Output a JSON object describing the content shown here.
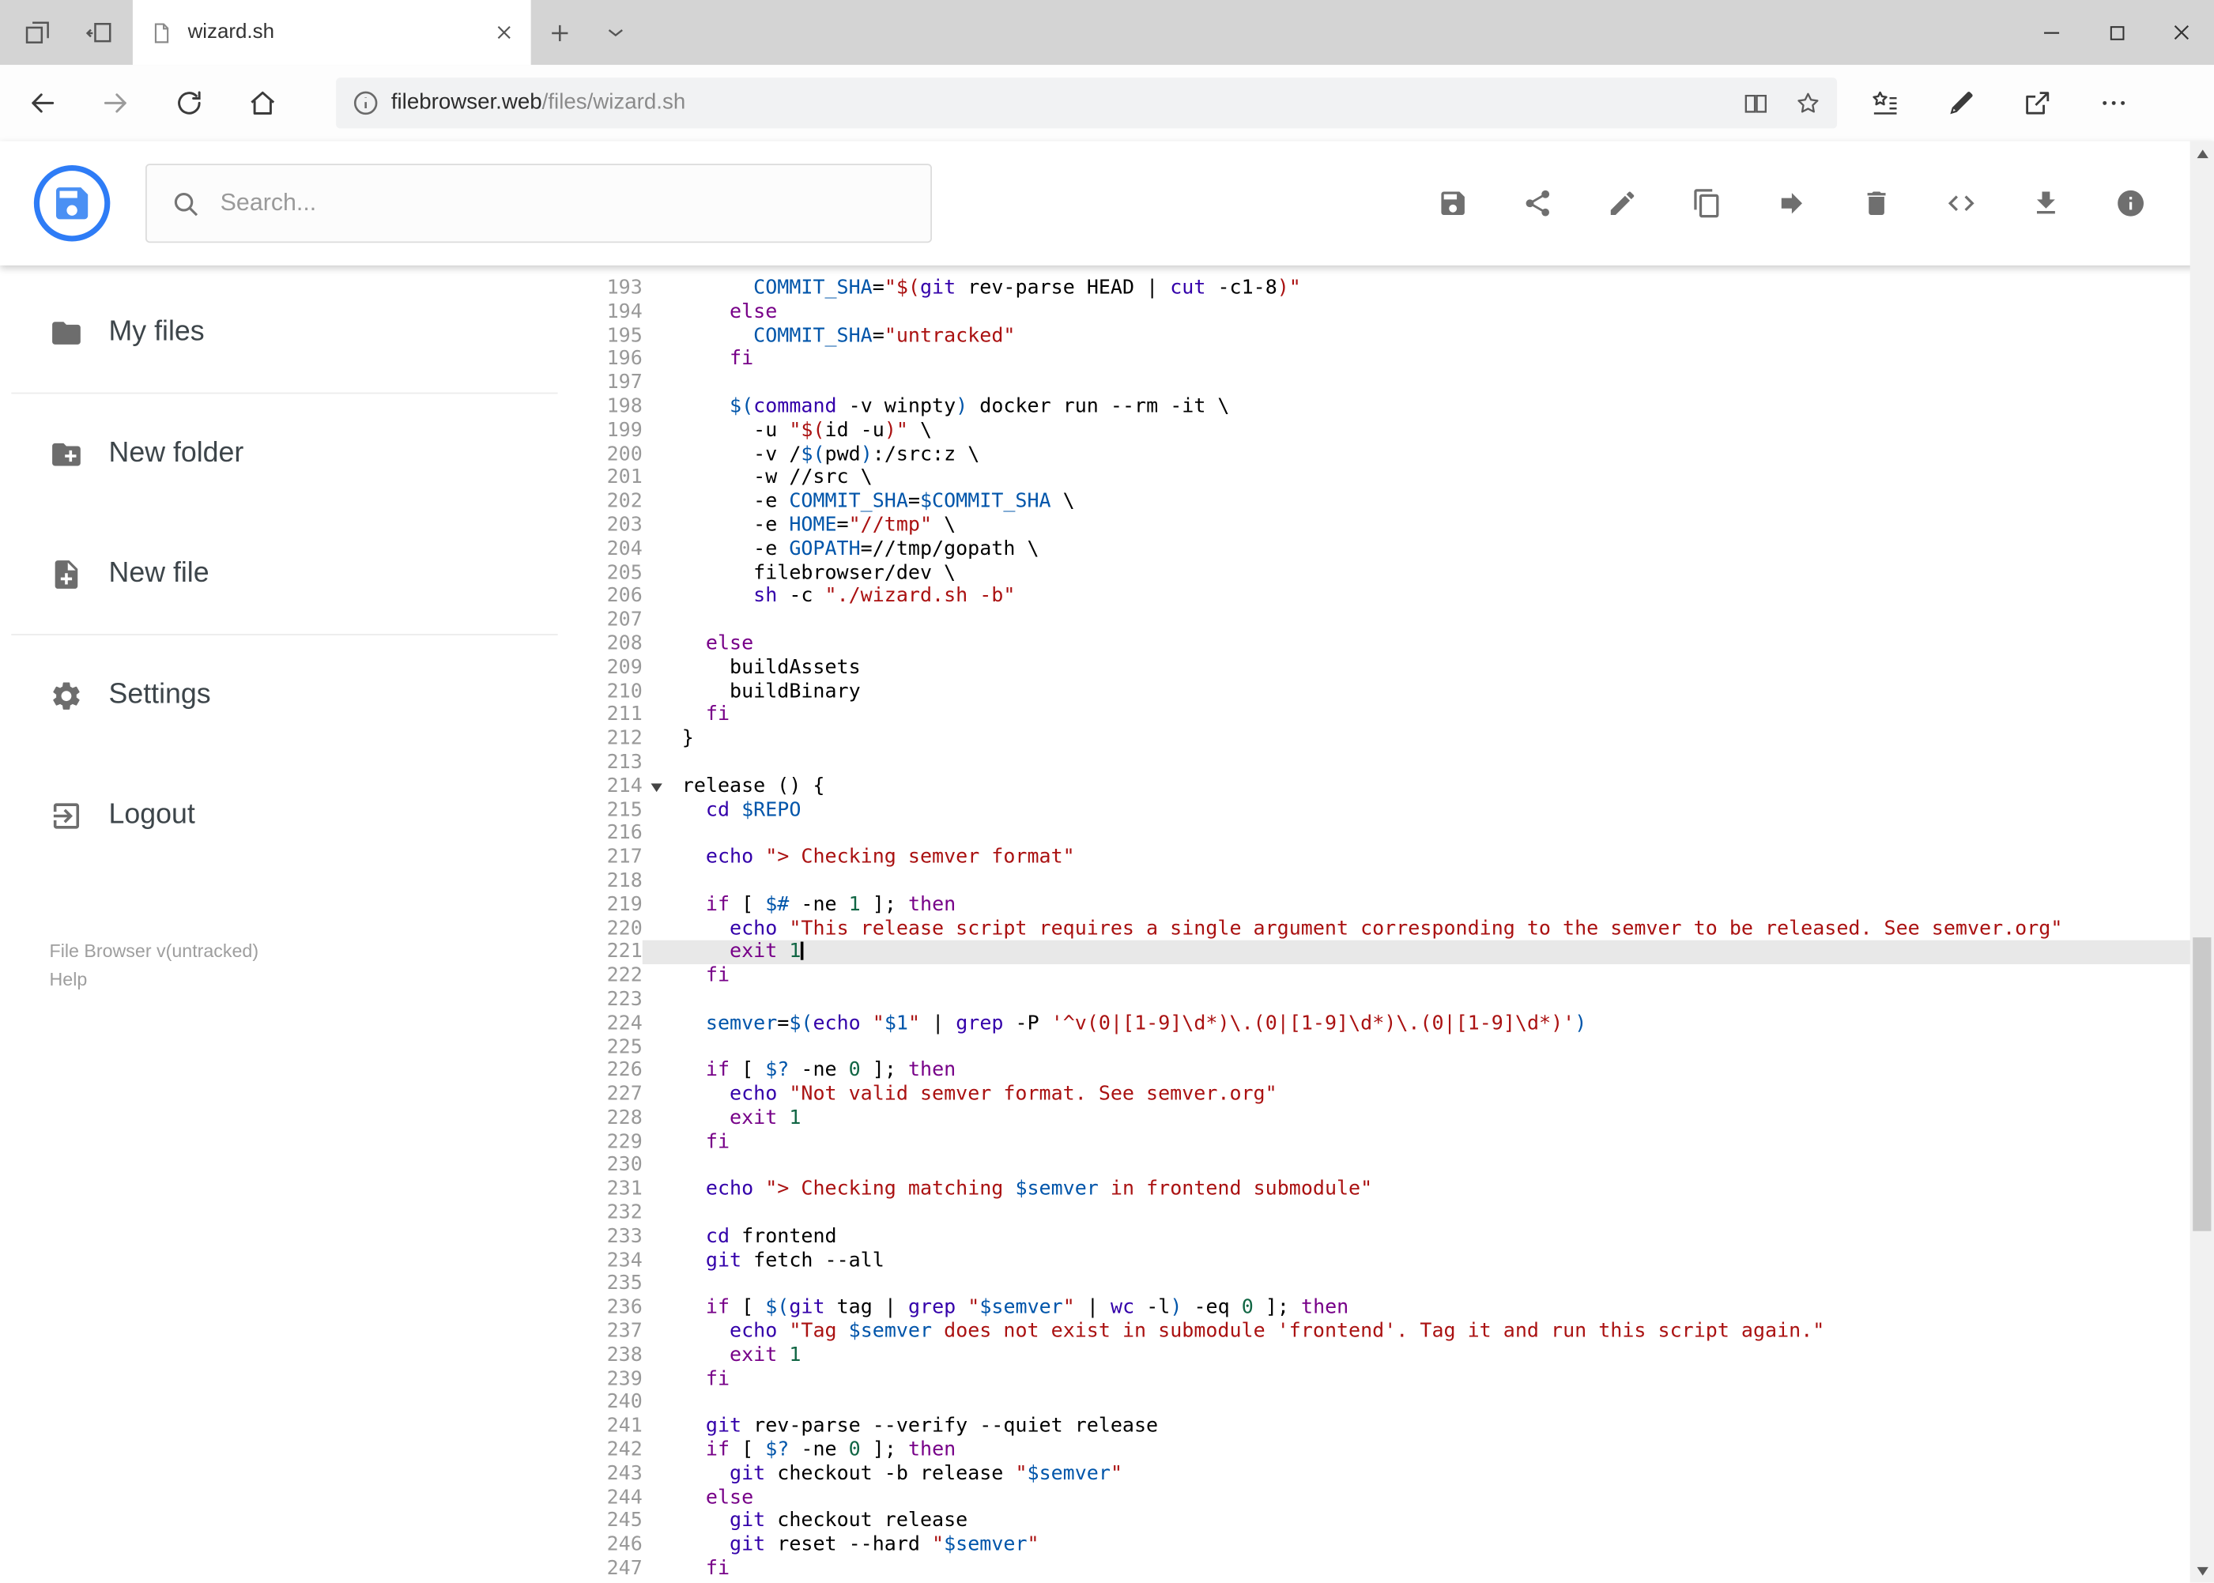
{
  "browser": {
    "tab_title": "wizard.sh",
    "url_domain": "filebrowser.web",
    "url_path": "/files/wizard.sh"
  },
  "header": {
    "search_placeholder": "Search...",
    "toolbar": [
      "save",
      "share",
      "edit",
      "copy",
      "move",
      "delete",
      "code",
      "download",
      "info"
    ]
  },
  "sidebar": {
    "items": [
      {
        "id": "my-files",
        "label": "My files",
        "icon": "folder-icon",
        "divider_after": true
      },
      {
        "id": "new-folder",
        "label": "New folder",
        "icon": "new-folder-icon",
        "divider_after": false
      },
      {
        "id": "new-file",
        "label": "New file",
        "icon": "new-file-icon",
        "divider_after": true
      },
      {
        "id": "settings",
        "label": "Settings",
        "icon": "settings-icon",
        "divider_after": false
      },
      {
        "id": "logout",
        "label": "Logout",
        "icon": "logout-icon",
        "divider_after": false
      }
    ],
    "footer": {
      "version": "File Browser v(untracked)",
      "help": "Help"
    }
  },
  "colors": {
    "accent_blue": "#2e7cf6",
    "tok_string": "#aa1111",
    "tok_keyword": "#770088",
    "tok_variable": "#0055aa",
    "tok_builtin": "#3300aa",
    "tok_number": "#116644"
  },
  "editor": {
    "active_line": 221,
    "fold_line": 214,
    "lines": [
      {
        "n": 193,
        "t": [
          [
            "      ",
            ""
          ],
          [
            "COMMIT_SHA",
            "v"
          ],
          [
            "=",
            ""
          ],
          [
            "\"$(",
            "s"
          ],
          [
            "git",
            "b"
          ],
          [
            " rev-parse HEAD | ",
            ""
          ],
          [
            "cut",
            "b"
          ],
          [
            " -c1-8",
            ""
          ],
          [
            ")\"",
            "s"
          ]
        ]
      },
      {
        "n": 194,
        "t": [
          [
            "    ",
            ""
          ],
          [
            "else",
            "k"
          ]
        ]
      },
      {
        "n": 195,
        "t": [
          [
            "      ",
            ""
          ],
          [
            "COMMIT_SHA",
            "v"
          ],
          [
            "=",
            ""
          ],
          [
            "\"untracked\"",
            "s"
          ]
        ]
      },
      {
        "n": 196,
        "t": [
          [
            "    ",
            ""
          ],
          [
            "fi",
            "k"
          ]
        ]
      },
      {
        "n": 197,
        "t": []
      },
      {
        "n": 198,
        "t": [
          [
            "    ",
            ""
          ],
          [
            "$(",
            "v"
          ],
          [
            "command",
            "b"
          ],
          [
            " -v winpty",
            ""
          ],
          [
            ")",
            "v"
          ],
          [
            " docker run --rm -it \\",
            ""
          ]
        ]
      },
      {
        "n": 199,
        "t": [
          [
            "      -u ",
            ""
          ],
          [
            "\"$(",
            "s"
          ],
          [
            "id -u",
            ""
          ],
          [
            ")\"",
            "s"
          ],
          [
            " \\",
            ""
          ]
        ]
      },
      {
        "n": 200,
        "t": [
          [
            "      -v /",
            ""
          ],
          [
            "$(",
            "v"
          ],
          [
            "pwd",
            ""
          ],
          [
            ")",
            "v"
          ],
          [
            ":/src:z \\",
            ""
          ]
        ]
      },
      {
        "n": 201,
        "t": [
          [
            "      -w //src \\",
            ""
          ]
        ]
      },
      {
        "n": 202,
        "t": [
          [
            "      -e ",
            ""
          ],
          [
            "COMMIT_SHA",
            "v"
          ],
          [
            "=",
            ""
          ],
          [
            "$COMMIT_SHA",
            "v"
          ],
          [
            " \\",
            ""
          ]
        ]
      },
      {
        "n": 203,
        "t": [
          [
            "      -e ",
            ""
          ],
          [
            "HOME",
            "v"
          ],
          [
            "=",
            ""
          ],
          [
            "\"//tmp\"",
            "s"
          ],
          [
            " \\",
            ""
          ]
        ]
      },
      {
        "n": 204,
        "t": [
          [
            "      -e ",
            ""
          ],
          [
            "GOPATH",
            "v"
          ],
          [
            "=//tmp/gopath \\",
            ""
          ]
        ]
      },
      {
        "n": 205,
        "t": [
          [
            "      filebrowser/dev \\",
            ""
          ]
        ]
      },
      {
        "n": 206,
        "t": [
          [
            "      ",
            ""
          ],
          [
            "sh",
            "b"
          ],
          [
            " -c ",
            ""
          ],
          [
            "\"./wizard.sh -b\"",
            "s"
          ]
        ]
      },
      {
        "n": 207,
        "t": []
      },
      {
        "n": 208,
        "t": [
          [
            "  ",
            ""
          ],
          [
            "else",
            "k"
          ]
        ]
      },
      {
        "n": 209,
        "t": [
          [
            "    buildAssets",
            ""
          ]
        ]
      },
      {
        "n": 210,
        "t": [
          [
            "    buildBinary",
            ""
          ]
        ]
      },
      {
        "n": 211,
        "t": [
          [
            "  ",
            ""
          ],
          [
            "fi",
            "k"
          ]
        ]
      },
      {
        "n": 212,
        "t": [
          [
            "}",
            ""
          ]
        ]
      },
      {
        "n": 213,
        "t": []
      },
      {
        "n": 214,
        "t": [
          [
            "release () {",
            ""
          ]
        ]
      },
      {
        "n": 215,
        "t": [
          [
            "  ",
            ""
          ],
          [
            "cd",
            "b"
          ],
          [
            " ",
            ""
          ],
          [
            "$REPO",
            "v"
          ]
        ]
      },
      {
        "n": 216,
        "t": []
      },
      {
        "n": 217,
        "t": [
          [
            "  ",
            ""
          ],
          [
            "echo",
            "b"
          ],
          [
            " ",
            ""
          ],
          [
            "\"> Checking semver format\"",
            "s"
          ]
        ]
      },
      {
        "n": 218,
        "t": []
      },
      {
        "n": 219,
        "t": [
          [
            "  ",
            ""
          ],
          [
            "if",
            "k"
          ],
          [
            " [ ",
            ""
          ],
          [
            "$#",
            "v"
          ],
          [
            " -ne ",
            ""
          ],
          [
            "1",
            "n"
          ],
          [
            " ]; ",
            ""
          ],
          [
            "then",
            "k"
          ]
        ]
      },
      {
        "n": 220,
        "t": [
          [
            "    ",
            ""
          ],
          [
            "echo",
            "b"
          ],
          [
            " ",
            ""
          ],
          [
            "\"This release script requires a single argument corresponding to the semver to be released. See semver.org\"",
            "s"
          ]
        ]
      },
      {
        "n": 221,
        "t": [
          [
            "    ",
            ""
          ],
          [
            "exit",
            "k"
          ],
          [
            " ",
            ""
          ],
          [
            "1",
            "n"
          ]
        ]
      },
      {
        "n": 222,
        "t": [
          [
            "  ",
            ""
          ],
          [
            "fi",
            "k"
          ]
        ]
      },
      {
        "n": 223,
        "t": []
      },
      {
        "n": 224,
        "t": [
          [
            "  ",
            ""
          ],
          [
            "semver",
            "v"
          ],
          [
            "=",
            ""
          ],
          [
            "$(",
            "v"
          ],
          [
            "echo",
            "b"
          ],
          [
            " ",
            ""
          ],
          [
            "\"",
            "s"
          ],
          [
            "$1",
            "v"
          ],
          [
            "\"",
            "s"
          ],
          [
            " | ",
            ""
          ],
          [
            "grep",
            "b"
          ],
          [
            " -P ",
            ""
          ],
          [
            "'^v(0|[1-9]\\d*)\\.(0|[1-9]\\d*)\\.(0|[1-9]\\d*)'",
            "s"
          ],
          [
            ")",
            "v"
          ]
        ]
      },
      {
        "n": 225,
        "t": []
      },
      {
        "n": 226,
        "t": [
          [
            "  ",
            ""
          ],
          [
            "if",
            "k"
          ],
          [
            " [ ",
            ""
          ],
          [
            "$?",
            "v"
          ],
          [
            " -ne ",
            ""
          ],
          [
            "0",
            "n"
          ],
          [
            " ]; ",
            ""
          ],
          [
            "then",
            "k"
          ]
        ]
      },
      {
        "n": 227,
        "t": [
          [
            "    ",
            ""
          ],
          [
            "echo",
            "b"
          ],
          [
            " ",
            ""
          ],
          [
            "\"Not valid semver format. See semver.org\"",
            "s"
          ]
        ]
      },
      {
        "n": 228,
        "t": [
          [
            "    ",
            ""
          ],
          [
            "exit",
            "k"
          ],
          [
            " ",
            ""
          ],
          [
            "1",
            "n"
          ]
        ]
      },
      {
        "n": 229,
        "t": [
          [
            "  ",
            ""
          ],
          [
            "fi",
            "k"
          ]
        ]
      },
      {
        "n": 230,
        "t": []
      },
      {
        "n": 231,
        "t": [
          [
            "  ",
            ""
          ],
          [
            "echo",
            "b"
          ],
          [
            " ",
            ""
          ],
          [
            "\"> Checking matching ",
            "s"
          ],
          [
            "$semver",
            "v"
          ],
          [
            " in frontend submodule\"",
            "s"
          ]
        ]
      },
      {
        "n": 232,
        "t": []
      },
      {
        "n": 233,
        "t": [
          [
            "  ",
            ""
          ],
          [
            "cd",
            "b"
          ],
          [
            " frontend",
            ""
          ]
        ]
      },
      {
        "n": 234,
        "t": [
          [
            "  ",
            ""
          ],
          [
            "git",
            "b"
          ],
          [
            " fetch --all",
            ""
          ]
        ]
      },
      {
        "n": 235,
        "t": []
      },
      {
        "n": 236,
        "t": [
          [
            "  ",
            ""
          ],
          [
            "if",
            "k"
          ],
          [
            " [ ",
            ""
          ],
          [
            "$(",
            "v"
          ],
          [
            "git",
            "b"
          ],
          [
            " tag | ",
            ""
          ],
          [
            "grep",
            "b"
          ],
          [
            " ",
            ""
          ],
          [
            "\"",
            "s"
          ],
          [
            "$semver",
            "v"
          ],
          [
            "\"",
            "s"
          ],
          [
            " | ",
            ""
          ],
          [
            "wc",
            "b"
          ],
          [
            " -l",
            ""
          ],
          [
            ")",
            "v"
          ],
          [
            " -eq ",
            ""
          ],
          [
            "0",
            "n"
          ],
          [
            " ]; ",
            ""
          ],
          [
            "then",
            "k"
          ]
        ]
      },
      {
        "n": 237,
        "t": [
          [
            "    ",
            ""
          ],
          [
            "echo",
            "b"
          ],
          [
            " ",
            ""
          ],
          [
            "\"Tag ",
            "s"
          ],
          [
            "$semver",
            "v"
          ],
          [
            " does not exist in submodule 'frontend'. Tag it and run this script again.\"",
            "s"
          ]
        ]
      },
      {
        "n": 238,
        "t": [
          [
            "    ",
            ""
          ],
          [
            "exit",
            "k"
          ],
          [
            " ",
            ""
          ],
          [
            "1",
            "n"
          ]
        ]
      },
      {
        "n": 239,
        "t": [
          [
            "  ",
            ""
          ],
          [
            "fi",
            "k"
          ]
        ]
      },
      {
        "n": 240,
        "t": []
      },
      {
        "n": 241,
        "t": [
          [
            "  ",
            ""
          ],
          [
            "git",
            "b"
          ],
          [
            " rev-parse --verify --quiet release",
            ""
          ]
        ]
      },
      {
        "n": 242,
        "t": [
          [
            "  ",
            ""
          ],
          [
            "if",
            "k"
          ],
          [
            " [ ",
            ""
          ],
          [
            "$?",
            "v"
          ],
          [
            " -ne ",
            ""
          ],
          [
            "0",
            "n"
          ],
          [
            " ]; ",
            ""
          ],
          [
            "then",
            "k"
          ]
        ]
      },
      {
        "n": 243,
        "t": [
          [
            "    ",
            ""
          ],
          [
            "git",
            "b"
          ],
          [
            " checkout -b release ",
            ""
          ],
          [
            "\"",
            "s"
          ],
          [
            "$semver",
            "v"
          ],
          [
            "\"",
            "s"
          ]
        ]
      },
      {
        "n": 244,
        "t": [
          [
            "  ",
            ""
          ],
          [
            "else",
            "k"
          ]
        ]
      },
      {
        "n": 245,
        "t": [
          [
            "    ",
            ""
          ],
          [
            "git",
            "b"
          ],
          [
            " checkout release",
            ""
          ]
        ]
      },
      {
        "n": 246,
        "t": [
          [
            "    ",
            ""
          ],
          [
            "git",
            "b"
          ],
          [
            " reset --hard ",
            ""
          ],
          [
            "\"",
            "s"
          ],
          [
            "$semver",
            "v"
          ],
          [
            "\"",
            "s"
          ]
        ]
      },
      {
        "n": 247,
        "t": [
          [
            "  ",
            ""
          ],
          [
            "fi",
            "k"
          ]
        ]
      }
    ]
  }
}
